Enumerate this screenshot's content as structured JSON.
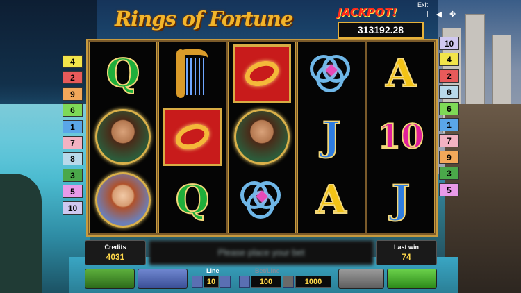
{
  "header": {
    "title": "Rings of Fortune",
    "jackpot_label": "JACKPOT!",
    "jackpot_value": "313192.28",
    "exit_label": "Exit",
    "icons": [
      "info-icon",
      "sound-icon",
      "fullscreen-icon"
    ]
  },
  "paylines_left": [
    {
      "num": "4",
      "color": "#f2e44a"
    },
    {
      "num": "2",
      "color": "#e85a5a"
    },
    {
      "num": "9",
      "color": "#f2a85a"
    },
    {
      "num": "6",
      "color": "#7ed957"
    },
    {
      "num": "1",
      "color": "#5aa6e8"
    },
    {
      "num": "7",
      "color": "#f2b2c2"
    },
    {
      "num": "8",
      "color": "#b8d9ea"
    },
    {
      "num": "3",
      "color": "#4aa84a"
    },
    {
      "num": "5",
      "color": "#e89ae8"
    },
    {
      "num": "10",
      "color": "#d0c8f0"
    }
  ],
  "paylines_right": [
    {
      "num": "10",
      "color": "#d0c8f0"
    },
    {
      "num": "4",
      "color": "#f2e44a"
    },
    {
      "num": "2",
      "color": "#e85a5a"
    },
    {
      "num": "8",
      "color": "#b8d9ea"
    },
    {
      "num": "6",
      "color": "#7ed957"
    },
    {
      "num": "1",
      "color": "#5aa6e8"
    },
    {
      "num": "7",
      "color": "#f2b2c2"
    },
    {
      "num": "9",
      "color": "#f2a85a"
    },
    {
      "num": "3",
      "color": "#4aa84a"
    },
    {
      "num": "5",
      "color": "#e89ae8"
    }
  ],
  "reels": [
    [
      "Q",
      "prince",
      "princess"
    ],
    [
      "harp",
      "ring",
      "Q"
    ],
    [
      "ring",
      "prince",
      "knot"
    ],
    [
      "knot",
      "J",
      "A"
    ],
    [
      "A",
      "10",
      "J"
    ]
  ],
  "status": {
    "credits_label": "Credits",
    "credits_value": "4031",
    "message": "Please place your bet",
    "last_win_label": "Last win",
    "last_win_value": "74"
  },
  "controls": {
    "line_label": "Line",
    "lines_value": "10",
    "bet_per_line_label": "Bet/Line",
    "bet_per_line_value": "100",
    "total_bet_value": "1000"
  }
}
